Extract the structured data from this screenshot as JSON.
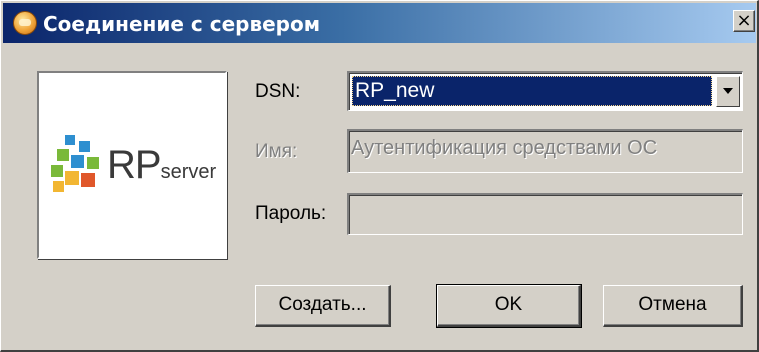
{
  "window": {
    "title": "Соединение с сервером",
    "close_glyph": "×",
    "icon": "app-icon"
  },
  "logo": {
    "rp": "RP",
    "server": "server",
    "icon": "rpserver-logo-icon",
    "colors": [
      "#2e8fd0",
      "#7ab93a",
      "#f2b632",
      "#e0572a"
    ]
  },
  "form": {
    "dsn": {
      "label": "DSN:",
      "value": "RP_new",
      "selection_color": "#0a246a"
    },
    "name": {
      "label": "Имя:",
      "value": "Аутентификация средствами ОС",
      "disabled": true
    },
    "password": {
      "label": "Пароль:",
      "value": "",
      "disabled": true
    }
  },
  "buttons": {
    "create": "Создать...",
    "ok": "OK",
    "cancel": "Отмена"
  },
  "colors": {
    "face": "#d4d0c8",
    "title_gradient_start": "#0a246a",
    "title_gradient_end": "#a6caf0"
  }
}
